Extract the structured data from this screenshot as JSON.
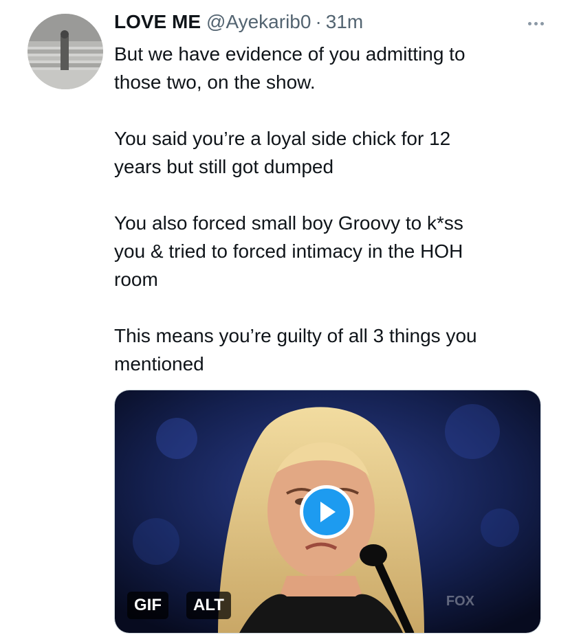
{
  "tweet": {
    "author_name": "LOVE ME",
    "handle": "@Ayekarib0",
    "separator": "·",
    "time": "31m",
    "paragraphs": [
      "But we have evidence of you admitting to\nthose two, on the show.",
      "You said you’re a loyal side chick for 12\nyears but still got dumped",
      "You also forced small boy Groovy to k*ss\nyou & tried to forced intimacy in the HOH\nroom",
      "This means you’re guilty of all 3 things you\nmentioned"
    ]
  },
  "media": {
    "type_badge": "GIF",
    "alt_badge": "ALT",
    "watermark": "FOX"
  },
  "icons": {
    "more": "more-horizontal-icon",
    "play": "play-icon"
  },
  "colors": {
    "accent": "#1d9bf0",
    "text": "#0f1419",
    "muted": "#536471"
  }
}
